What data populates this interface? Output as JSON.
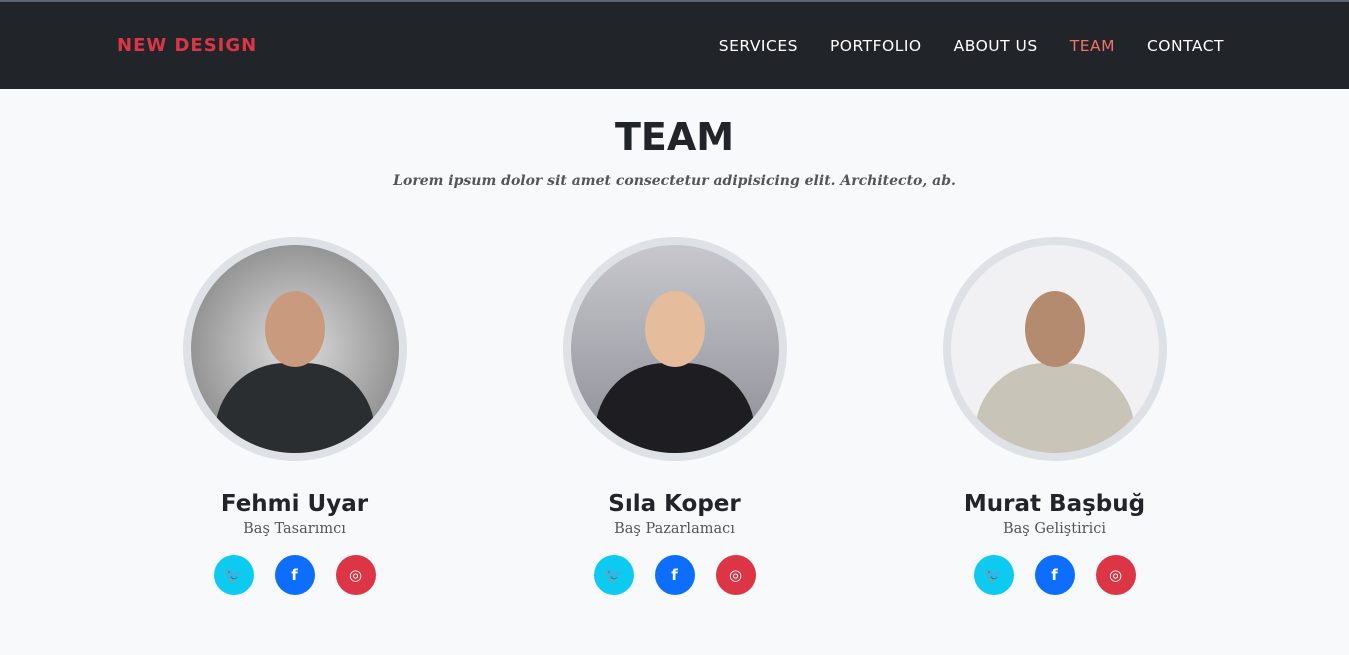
{
  "nav": {
    "brand": "NEW DESIGN",
    "links": [
      "SERVICES",
      "PORTFOLIO",
      "ABOUT US",
      "TEAM",
      "CONTACT"
    ],
    "active": "TEAM"
  },
  "section": {
    "title": "TEAM",
    "subtitle": "Lorem ipsum dolor sit amet consectetur adipisicing elit. Architecto, ab."
  },
  "members": [
    {
      "name": "Fehmi Uyar",
      "role": "Baş Tasarımcı"
    },
    {
      "name": "Sıla Koper",
      "role": "Baş Pazarlamacı"
    },
    {
      "name": "Murat Başbuğ",
      "role": "Baş Geliştirici"
    }
  ],
  "colors": {
    "brand": "#dc3545",
    "navbar": "#212529",
    "twitter": "#0dcaf0",
    "facebook": "#0d6efd",
    "instagram": "#dc3545"
  }
}
